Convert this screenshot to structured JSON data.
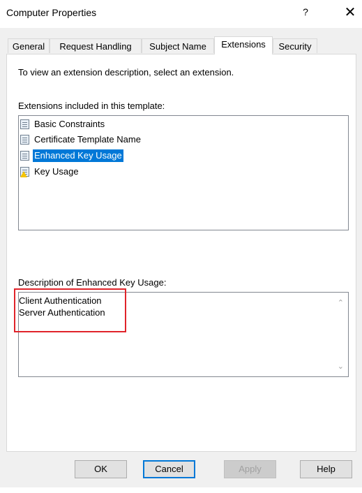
{
  "window": {
    "title": "Computer Properties",
    "help_label": "?",
    "close_label": "✕"
  },
  "tabs": [
    {
      "label": "General"
    },
    {
      "label": "Request Handling"
    },
    {
      "label": "Subject Name"
    },
    {
      "label": "Extensions"
    },
    {
      "label": "Security"
    }
  ],
  "active_tab": "Extensions",
  "extensions": {
    "instruction": "To view an extension description, select an extension.",
    "list_label": "Extensions included in this template:",
    "items": [
      {
        "label": "Basic Constraints",
        "icon": "certificate-doc-icon",
        "selected": false
      },
      {
        "label": "Certificate Template Name",
        "icon": "certificate-doc-icon",
        "selected": false
      },
      {
        "label": "Enhanced Key Usage",
        "icon": "certificate-doc-icon",
        "selected": true
      },
      {
        "label": "Key Usage",
        "icon": "certificate-warning-icon",
        "selected": false
      }
    ],
    "description_label": "Description of Enhanced Key Usage:",
    "description_lines": [
      "Client Authentication",
      "Server Authentication"
    ]
  },
  "buttons": {
    "ok": "OK",
    "cancel": "Cancel",
    "apply": "Apply",
    "help": "Help"
  },
  "colors": {
    "selection": "#0078d7",
    "highlight_border": "#e0232a"
  }
}
